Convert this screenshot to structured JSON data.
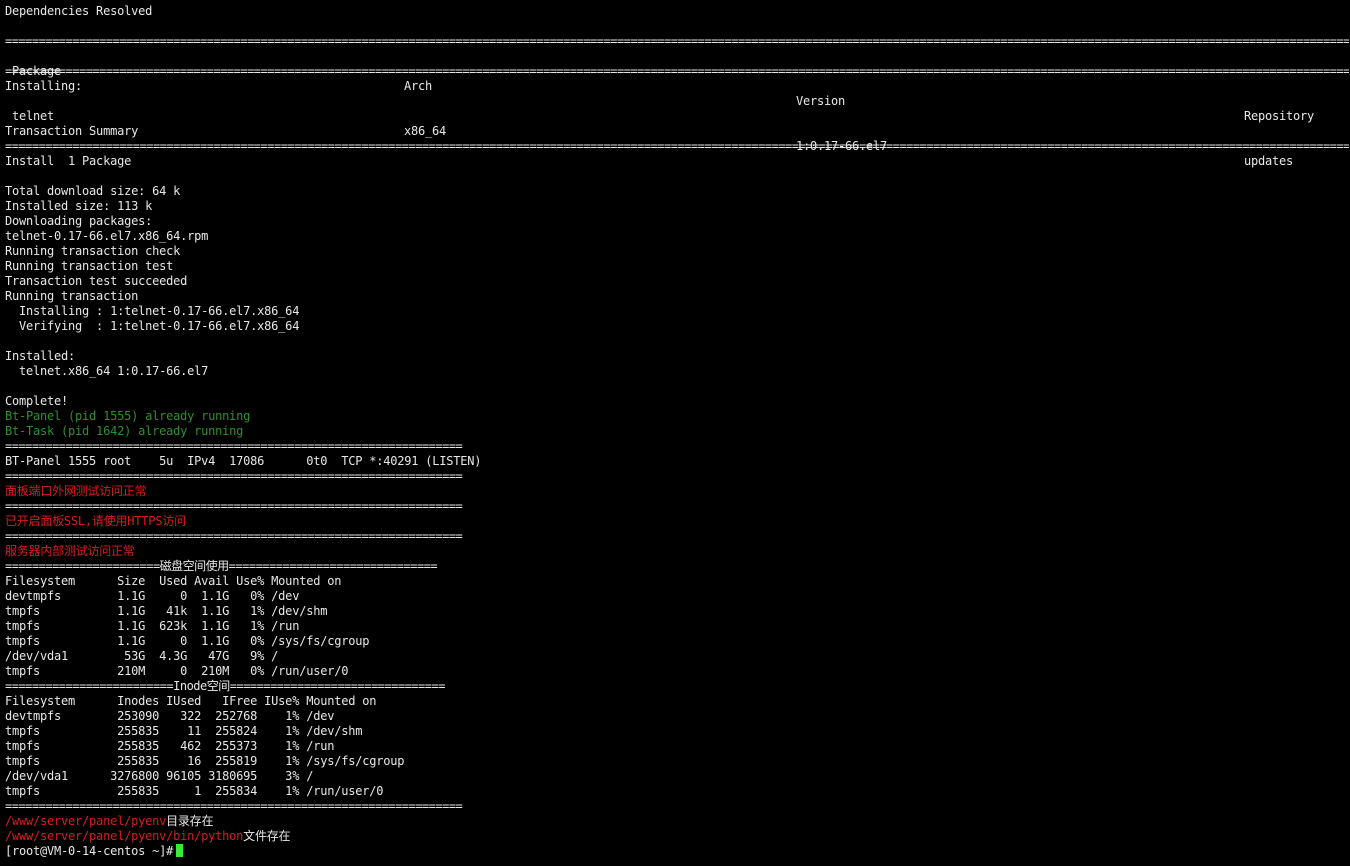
{
  "header": {
    "deps_resolved": "Dependencies Resolved"
  },
  "rule_wide": "===========================================================================================================================================================================================================================================",
  "rule_narrow": "====================================================================",
  "table": {
    "headers": {
      "package": "Package",
      "arch": "Arch",
      "version": "Version",
      "repository": "Repository"
    },
    "installing_label": "Installing:",
    "row": {
      "package": " telnet",
      "arch": "x86_64",
      "version": "1:0.17-66.el7",
      "repository": "updates"
    }
  },
  "summary": {
    "title": "Transaction Summary",
    "install": "Install  1 Package"
  },
  "log": [
    "Total download size: 64 k",
    "Installed size: 113 k",
    "Downloading packages:",
    "telnet-0.17-66.el7.x86_64.rpm",
    "Running transaction check",
    "Running transaction test",
    "Transaction test succeeded",
    "Running transaction",
    "  Installing : 1:telnet-0.17-66.el7.x86_64",
    "  Verifying  : 1:telnet-0.17-66.el7.x86_64"
  ],
  "installed": {
    "label": "Installed:",
    "item": "  telnet.x86_64 1:0.17-66.el7"
  },
  "complete": "Complete!",
  "status": [
    "Bt-Panel (pid 1555) already running",
    "Bt-Task (pid 1642) already running"
  ],
  "lsof_line": "BT-Panel 1555 root    5u  IPv4  17086      0t0  TCP *:40291 (LISTEN)",
  "messages": [
    "面板端口外网测试访问正常",
    "已开启面板SSL,请使用HTTPS访问",
    "服务器内部测试访问正常"
  ],
  "disk_title_rule": "=======================磁盘空间使用===============================",
  "disk": [
    "Filesystem      Size  Used Avail Use% Mounted on",
    "devtmpfs        1.1G     0  1.1G   0% /dev",
    "tmpfs           1.1G   41k  1.1G   1% /dev/shm",
    "tmpfs           1.1G  623k  1.1G   1% /run",
    "tmpfs           1.1G     0  1.1G   0% /sys/fs/cgroup",
    "/dev/vda1        53G  4.3G   47G   9% /",
    "tmpfs           210M     0  210M   0% /run/user/0"
  ],
  "inode_title_rule": "=========================Inode空间================================",
  "inode": [
    "Filesystem      Inodes IUsed   IFree IUse% Mounted on",
    "devtmpfs        253090   322  252768    1% /dev",
    "tmpfs           255835    11  255824    1% /dev/shm",
    "tmpfs           255835   462  255373    1% /run",
    "tmpfs           255835    16  255819    1% /sys/fs/cgroup",
    "/dev/vda1      3276800 96105 3180695    3% /",
    "tmpfs           255835     1  255834    1% /run/user/0"
  ],
  "pyenv": {
    "path1": "/www/server/panel/pyenv",
    "text1": "目录存在",
    "path2": "/www/server/panel/pyenv/bin/python",
    "text2": "文件存在"
  },
  "prompt": "[root@VM-0-14-centos ~]#"
}
